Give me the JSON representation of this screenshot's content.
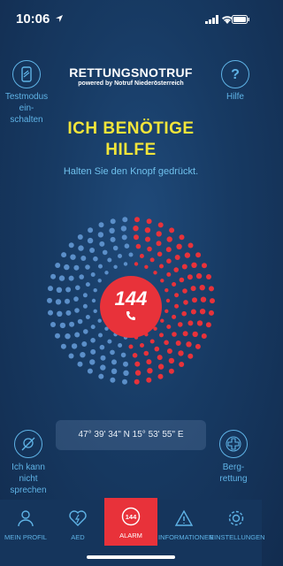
{
  "status": {
    "time": "10:06"
  },
  "header": {
    "brand_title": "RETTUNGSNOTRUF",
    "brand_subtitle": "powered by Notruf Niederösterreich",
    "test_mode_label": [
      "Testmodus",
      "ein-",
      "schalten"
    ],
    "help_label": "Hilfe"
  },
  "main": {
    "headline_line1": "ICH BENÖTIGE",
    "headline_line2": "HILFE",
    "hint": "Halten Sie den Knopf gedrückt.",
    "call_number": "144",
    "coordinates": "47° 39' 34\" N 15° 53' 55\" E",
    "speech_label": [
      "Ich kann",
      "nicht",
      "sprechen"
    ],
    "mountain_label": [
      "Berg-",
      "rettung"
    ]
  },
  "tabs": [
    {
      "label": "MEIN PROFIL",
      "icon": "profile-icon"
    },
    {
      "label": "AED",
      "icon": "aed-heart-icon"
    },
    {
      "label": "ALARM",
      "icon": "alarm-144-icon",
      "active": true
    },
    {
      "label": "INFORMATIONEN",
      "icon": "warning-icon"
    },
    {
      "label": "EINSTELLUNGEN",
      "icon": "settings-gear-icon"
    }
  ],
  "colors": {
    "accent_red": "#e8323a",
    "accent_blue": "#5fb3e6",
    "headline_yellow": "#f2e53a",
    "background": "#173a63"
  }
}
